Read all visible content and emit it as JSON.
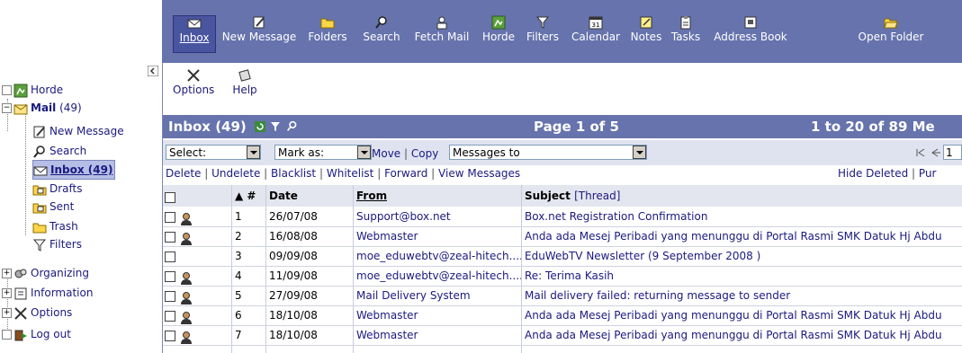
{
  "toolbar": {
    "items": [
      {
        "label": "Inbox",
        "icon": "envelope-icon"
      },
      {
        "label": "New Message",
        "icon": "new-message-icon"
      },
      {
        "label": "Folders",
        "icon": "folder-icon"
      },
      {
        "label": "Search",
        "icon": "search-icon"
      },
      {
        "label": "Fetch Mail",
        "icon": "fetch-mail-icon"
      },
      {
        "label": "Horde",
        "icon": "horde-icon"
      },
      {
        "label": "Filters",
        "icon": "filter-icon"
      },
      {
        "label": "Calendar",
        "icon": "calendar-icon"
      },
      {
        "label": "Notes",
        "icon": "notes-icon"
      },
      {
        "label": "Tasks",
        "icon": "tasks-icon"
      },
      {
        "label": "Address Book",
        "icon": "address-book-icon"
      },
      {
        "label": "Open Folder",
        "icon": "open-folder-icon"
      }
    ],
    "calendar_day": "31",
    "row2": [
      {
        "label": "Options",
        "icon": "options-icon"
      },
      {
        "label": "Help",
        "icon": "help-icon"
      }
    ]
  },
  "sidebar": {
    "horde": "Horde",
    "mail": "Mail",
    "mail_count": "(49)",
    "items": [
      {
        "label": "New Message"
      },
      {
        "label": "Search"
      },
      {
        "label": "Inbox (49)"
      },
      {
        "label": "Drafts"
      },
      {
        "label": "Sent"
      },
      {
        "label": "Trash"
      },
      {
        "label": "Filters"
      }
    ],
    "groups": [
      {
        "label": "Organizing"
      },
      {
        "label": "Information"
      },
      {
        "label": "Options"
      },
      {
        "label": "Log out"
      }
    ]
  },
  "inbox": {
    "title": "Inbox (49)",
    "page": "Page 1 of 5",
    "count": "1 to 20 of 89 Me",
    "select_label": "Select:",
    "mark_label": "Mark as:",
    "move": "Move",
    "copy": "Copy",
    "messages_to": "Messages to",
    "page_input": "1",
    "actions": {
      "delete": "Delete",
      "undelete": "Undelete",
      "blacklist": "Blacklist",
      "whitelist": "Whitelist",
      "forward": "Forward",
      "view_messages": "View Messages",
      "hide_deleted": "Hide Deleted",
      "purge": "Pur"
    }
  },
  "table": {
    "headers": {
      "sort": "▲",
      "num": "#",
      "date": "Date",
      "from": "From",
      "subject": "Subject",
      "thread": "[Thread]"
    },
    "rows": [
      {
        "num": "1",
        "date": "26/07/08",
        "from": "Support@box.net",
        "subject": "Box.net Registration Confirmation",
        "person": true
      },
      {
        "num": "2",
        "date": "16/08/08",
        "from": "Webmaster",
        "subject": "Anda ada Mesej Peribadi yang menunggu di Portal Rasmi SMK Datuk Hj Abdu",
        "person": true
      },
      {
        "num": "3",
        "date": "09/09/08",
        "from": "moe_eduwebtv@zeal-hitech....",
        "subject": "EduWebTV Newsletter (9 September 2008 )",
        "person": false
      },
      {
        "num": "4",
        "date": "11/09/08",
        "from": "moe_eduwebtv@zeal-hitech....",
        "subject": "Re: Terima Kasih",
        "person": true
      },
      {
        "num": "5",
        "date": "27/09/08",
        "from": "Mail Delivery System",
        "subject": "Mail delivery failed: returning message to sender",
        "person": true
      },
      {
        "num": "6",
        "date": "18/10/08",
        "from": "Webmaster",
        "subject": "Anda ada Mesej Peribadi yang menunggu di Portal Rasmi SMK Datuk Hj Abdu",
        "person": true
      },
      {
        "num": "7",
        "date": "18/10/08",
        "from": "Webmaster",
        "subject": "Anda ada Mesej Peribadi yang menunggu di Portal Rasmi SMK Datuk Hj Abdu",
        "person": true
      }
    ]
  },
  "colors": {
    "toolbar": "#6673ad",
    "link": "#1a1a80",
    "header_bg": "#e4e6ef"
  }
}
